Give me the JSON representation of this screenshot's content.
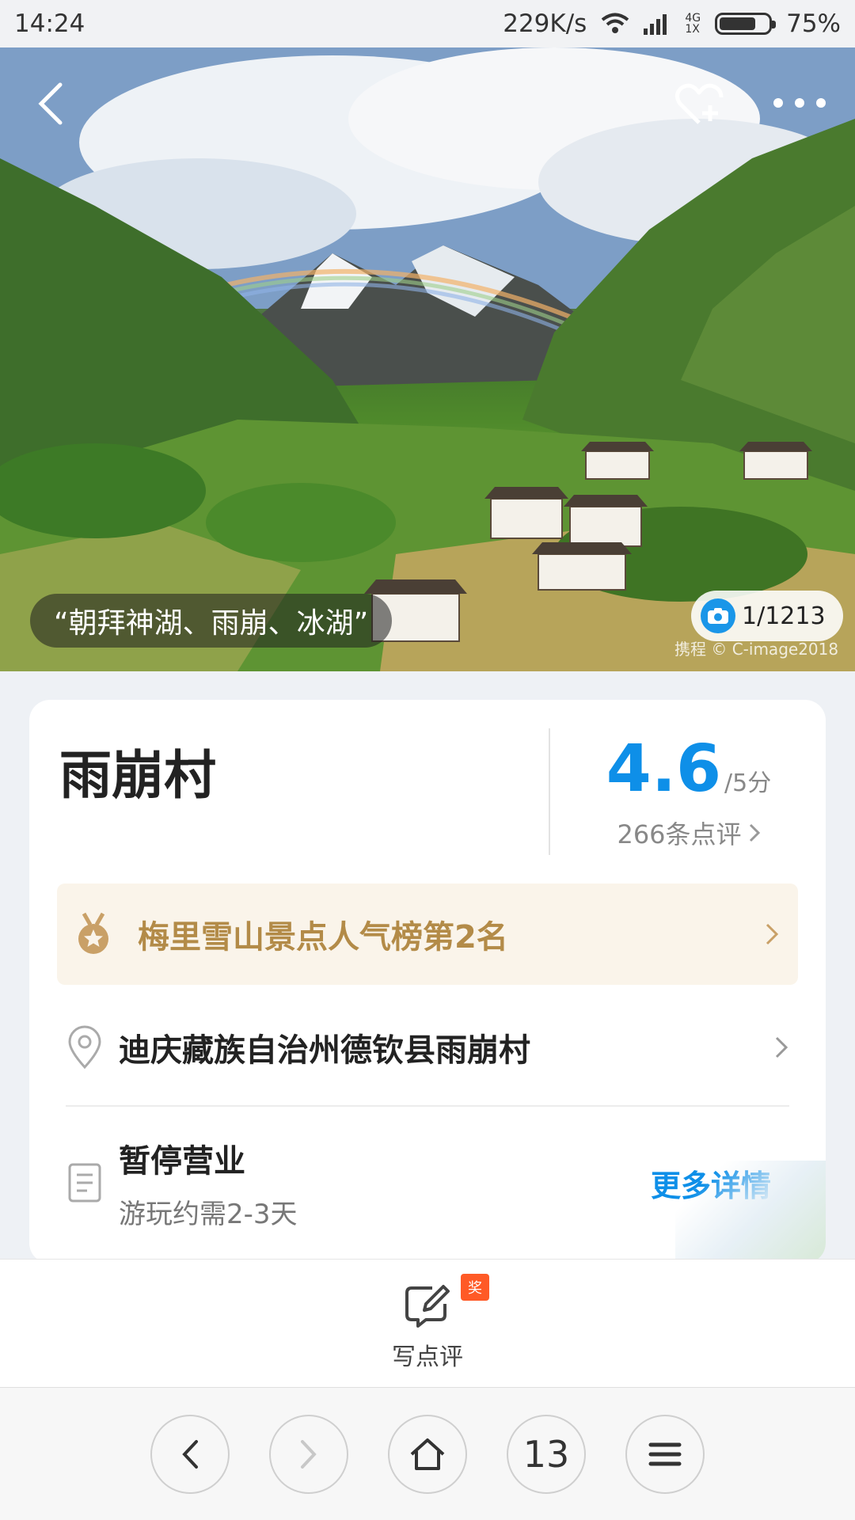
{
  "status_bar": {
    "time": "14:24",
    "speed": "229K/s",
    "net_top": "4G",
    "net_bottom": "1X",
    "battery": "75%",
    "battery_level": 0.75
  },
  "hero": {
    "caption": "“朝拜神湖、雨崩、冰湖”",
    "photo_count": "1/1213",
    "watermark": "携程 © C-image2018"
  },
  "attraction": {
    "name": "雨崩村",
    "score": "4.6",
    "score_max": "/5分",
    "reviews": "266条点评",
    "ranking": "梅里雪山景点人气榜第2名",
    "address": "迪庆藏族自治州德钦县雨崩村",
    "status": "暂停营业",
    "duration": "游玩约需2-3天",
    "more_details": "更多详情"
  },
  "review_bar": {
    "write_label": "写点评",
    "badge": "奖"
  },
  "browser_nav": {
    "tabs_count": "13"
  },
  "colors": {
    "accent_blue": "#0e8fe8",
    "rank_gold": "#b38b48",
    "badge_orange": "#ff5a26"
  },
  "icons": [
    "chevron-left-icon",
    "heart-plus-icon",
    "more-dots-icon",
    "camera-icon",
    "medal-icon",
    "location-pin-icon",
    "document-icon",
    "edit-icon",
    "chevron-right-icon",
    "home-icon",
    "menu-icon"
  ]
}
